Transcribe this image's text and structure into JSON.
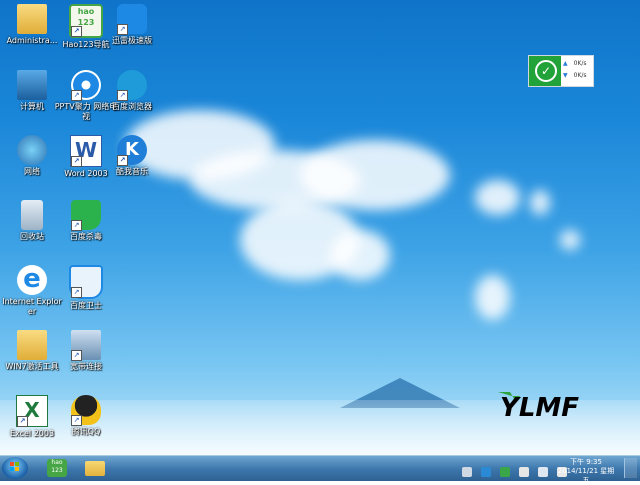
{
  "desktop_icons": [
    {
      "label": "Administra...",
      "icon": "user-folder-icon"
    },
    {
      "label": "Hao123导航",
      "icon": "hao123-icon",
      "logo_text": "hao\n123"
    },
    {
      "label": "迅雷极速版",
      "icon": "thunder-bird-icon"
    },
    {
      "label": "计算机",
      "icon": "computer-icon"
    },
    {
      "label": "PPTV聚力 网络电视",
      "icon": "pptv-icon"
    },
    {
      "label": "百度浏览器",
      "icon": "baidu-browser-icon"
    },
    {
      "label": "网络",
      "icon": "network-icon"
    },
    {
      "label": "Word 2003",
      "icon": "word-icon",
      "logo_text": "W"
    },
    {
      "label": "酷我音乐",
      "icon": "kuwo-icon",
      "logo_text": "K"
    },
    {
      "label": "回收站",
      "icon": "recycle-bin-icon"
    },
    {
      "label": "百度杀毒",
      "icon": "baidu-antivirus-icon"
    },
    {
      "label": "Internet Explorer",
      "icon": "ie-icon",
      "logo_text": "e"
    },
    {
      "label": "百度卫士",
      "icon": "baidu-guard-icon"
    },
    {
      "label": "WIN7激活工具",
      "icon": "folder-icon"
    },
    {
      "label": "宽带连接",
      "icon": "broadband-icon"
    },
    {
      "label": "Excel 2003",
      "icon": "excel-icon",
      "logo_text": "X"
    },
    {
      "label": "腾讯QQ",
      "icon": "qq-penguin-icon"
    }
  ],
  "net_widget": {
    "upload": "0K/s",
    "download": "0K/s"
  },
  "brand_logo": "YLMF",
  "taskbar": {
    "pinned": [
      {
        "icon": "hao123-icon",
        "logo_text": "hao\n123"
      },
      {
        "icon": "explorer-folder-icon"
      }
    ],
    "clock_time": "下午 9:35",
    "clock_date": "2014/11/21 星期五"
  },
  "colors": {
    "accent": "#22a33a",
    "taskbar": "#3e78ad"
  }
}
